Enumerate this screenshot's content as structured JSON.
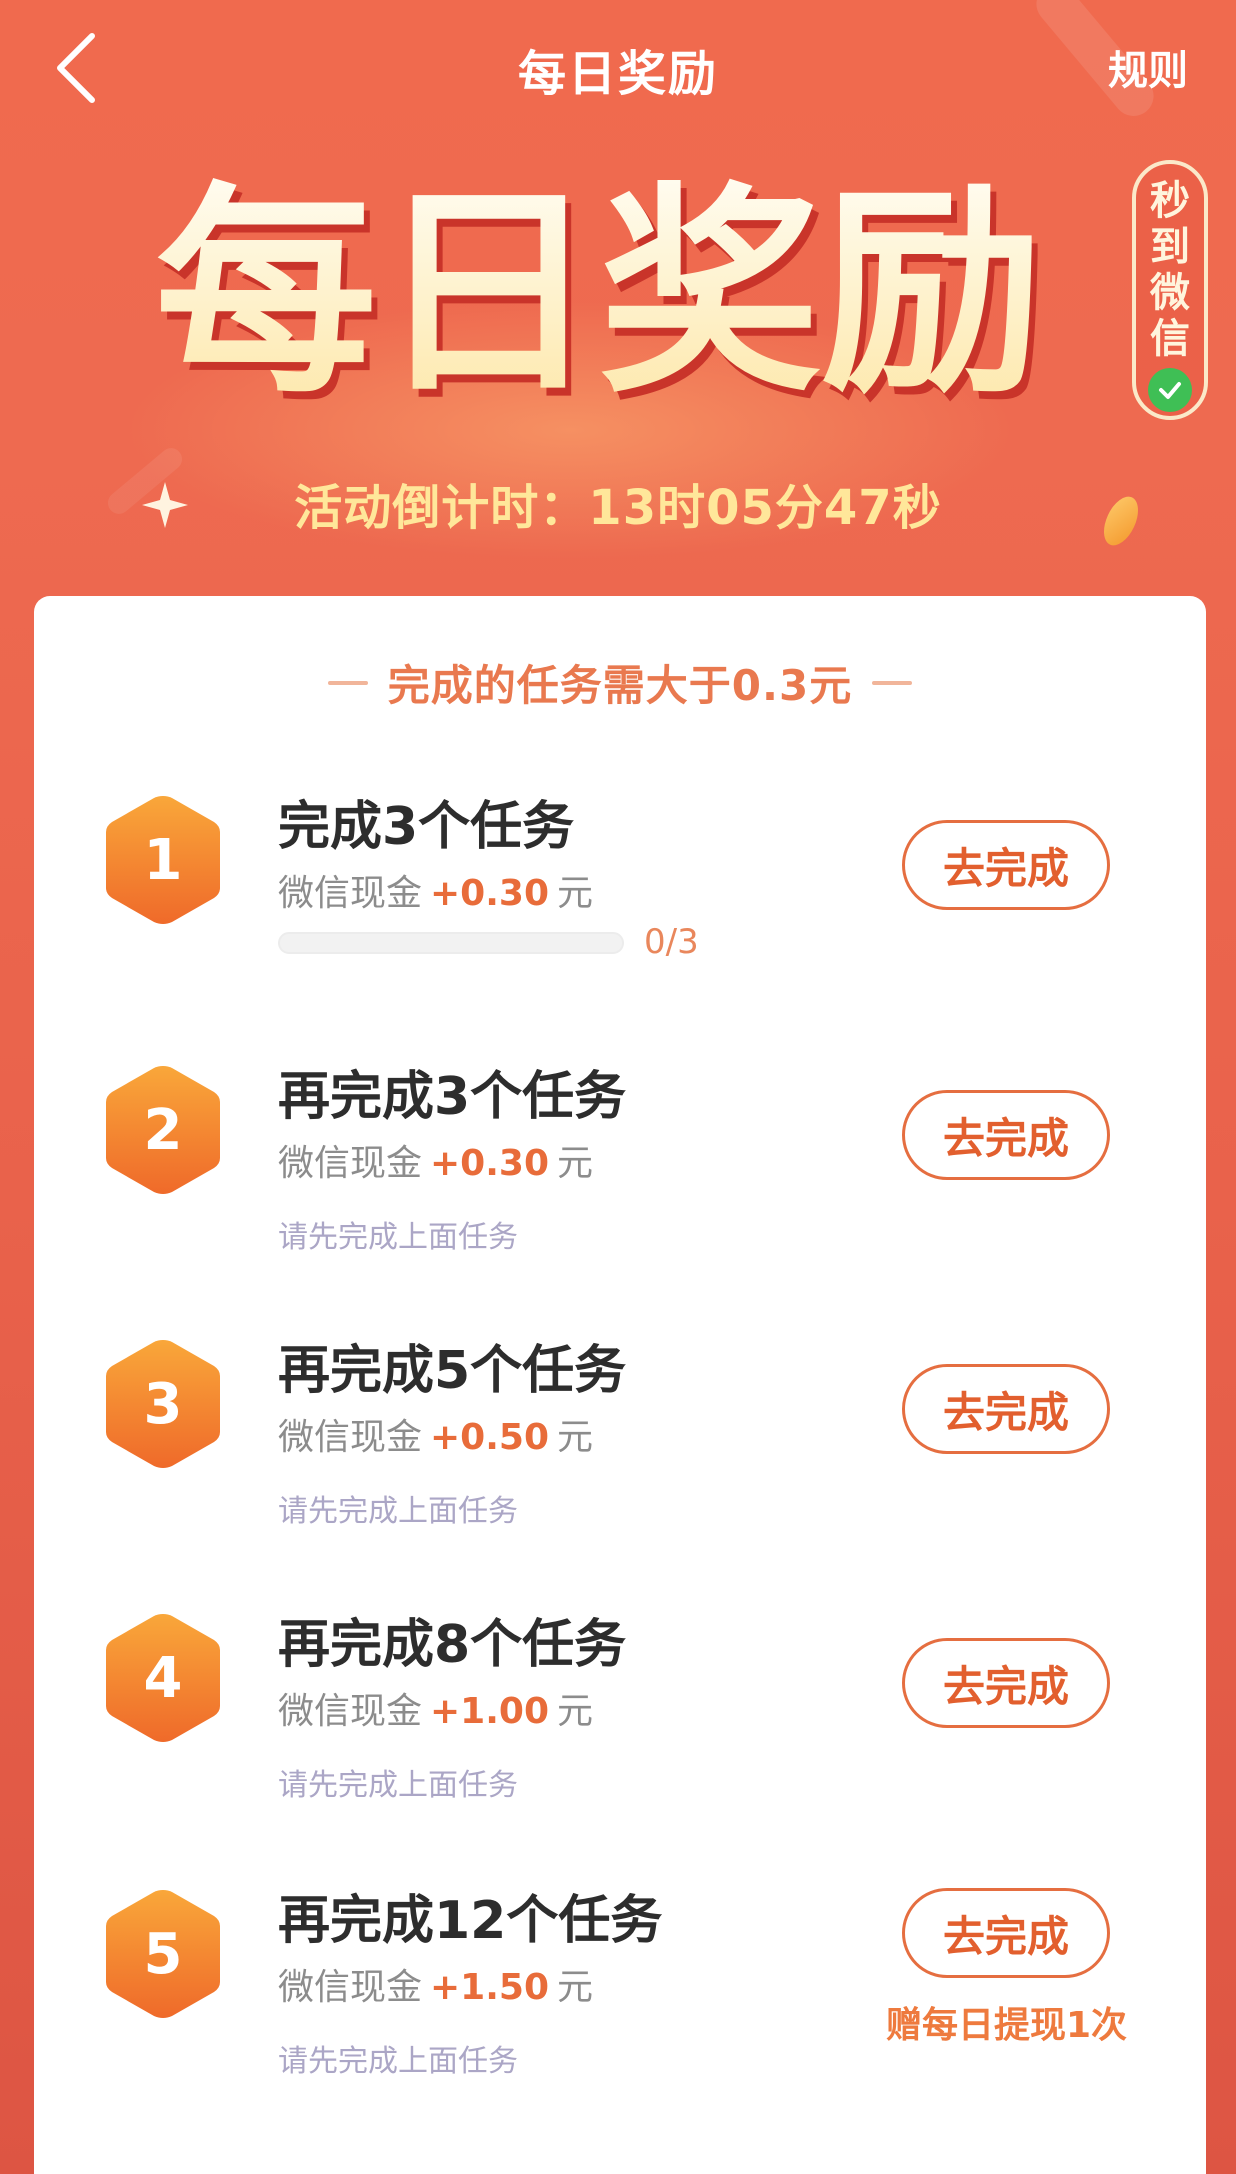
{
  "header": {
    "title": "每日奖励",
    "rules_label": "规则"
  },
  "hero": {
    "big_title": "每日奖励",
    "badge_text": "秒到微信",
    "countdown_prefix": "活动倒计时：",
    "countdown_value": "13时05分47秒"
  },
  "card": {
    "subtitle": "完成的任务需大于0.3元",
    "reward_prefix": "微信现金",
    "reward_unit": "元",
    "button_label": "去完成",
    "locked_hint": "请先完成上面任务",
    "tasks": [
      {
        "index": "1",
        "title": "完成3个任务",
        "amount": "+0.30",
        "progress_text": "0/3",
        "progress": 0
      },
      {
        "index": "2",
        "title": "再完成3个任务",
        "amount": "+0.30"
      },
      {
        "index": "3",
        "title": "再完成5个任务",
        "amount": "+0.50"
      },
      {
        "index": "4",
        "title": "再完成8个任务",
        "amount": "+1.00"
      },
      {
        "index": "5",
        "title": "再完成12个任务",
        "amount": "+1.50",
        "bonus": "赠每日提现1次"
      }
    ]
  },
  "colors": {
    "background": "#ee6a50",
    "accent": "#e56e40",
    "hex_gradient_top": "#f9a73a",
    "hex_gradient_bottom": "#ef6a2a",
    "hint": "#aba6c6",
    "countdown": "#ffe79a"
  },
  "icons": {
    "back": "chevron-left-icon",
    "badge_check": "check-circle-icon",
    "sparkle": "sparkle-icon",
    "coin": "coin-icon"
  }
}
